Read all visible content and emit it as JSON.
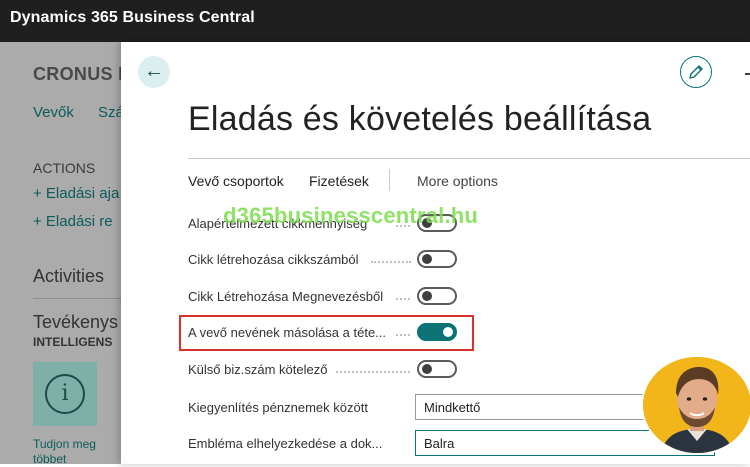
{
  "app": {
    "title": "Dynamics 365 Business Central"
  },
  "background": {
    "company": "CRONUS I",
    "nav": [
      "Vevők",
      "Szá"
    ],
    "actions_heading": "ACTIONS",
    "actions": [
      "+ Eladási aja",
      "+ Eladási re"
    ],
    "activities": "Activities",
    "tevekenyseg": "Tevékenys",
    "intelligens": "INTELLIGENS",
    "tile_icon": "info-icon",
    "tile_text": [
      "Tudjon meg",
      "többet"
    ]
  },
  "panel": {
    "title": "Eladás és követelés beállítása",
    "tabs": [
      "Vevő csoportok",
      "Fizetések",
      "More options"
    ],
    "fields": [
      {
        "label": "Alapértelmezett cikkmennyiség",
        "type": "toggle",
        "on": false
      },
      {
        "label": "Cikk létrehozása cikkszámból",
        "type": "toggle",
        "on": false
      },
      {
        "label": "Cikk Létrehozása Megnevezésből",
        "type": "toggle",
        "on": false
      },
      {
        "label": "A vevő nevének másolása a téte...",
        "type": "toggle",
        "on": true,
        "highlighted": true
      },
      {
        "label": "Külső biz.szám kötelező",
        "type": "toggle",
        "on": false
      },
      {
        "label": "Kiegyenlítés pénznemek között",
        "type": "select",
        "value": "Mindkettő"
      },
      {
        "label": "Embléma elhelyezkedése a dok...",
        "type": "select",
        "value": "Balra"
      }
    ]
  },
  "watermark": "d365businesscentral.hu",
  "colors": {
    "accent": "#0b7276",
    "highlight": "#d9322e",
    "topbar": "#1f1f1f",
    "watermark": "#7bde4c",
    "avatar_bg": "#f2b51a"
  }
}
